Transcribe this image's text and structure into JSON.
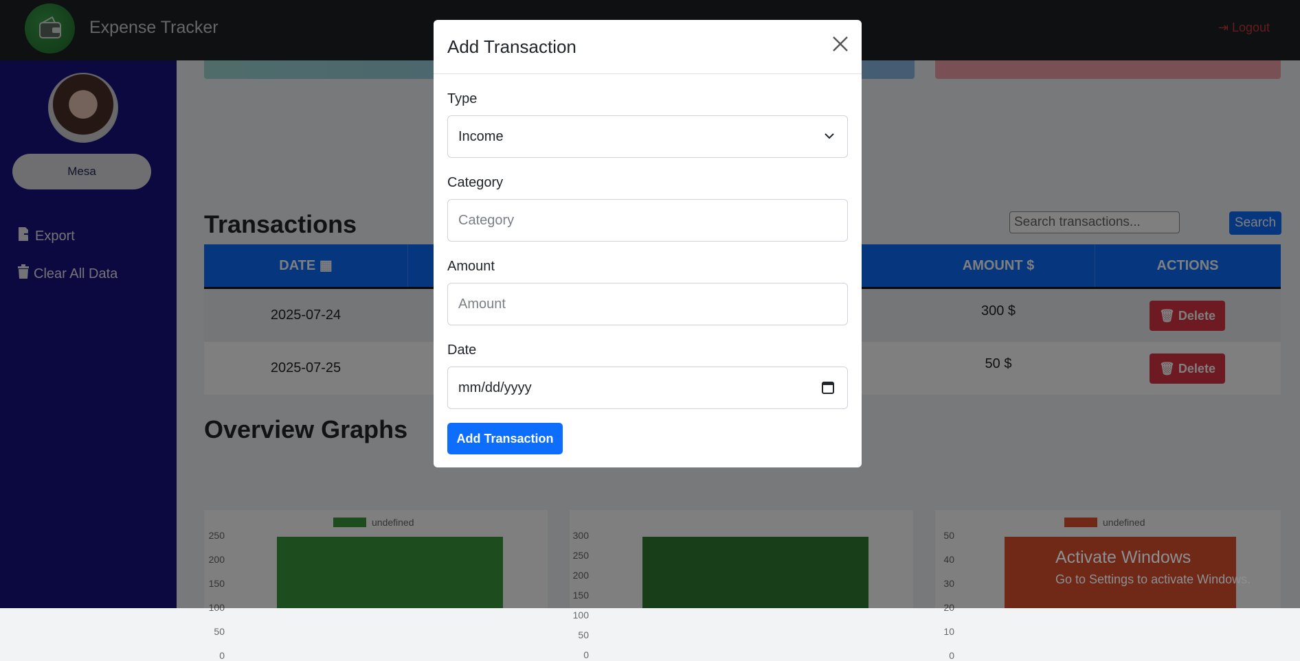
{
  "app": {
    "title": "Expense Tracker",
    "logout_label": "Logout"
  },
  "sidebar": {
    "user_name": "Mesa",
    "items": [
      {
        "label": "Export",
        "icon": "file-export-icon"
      },
      {
        "label": "Clear All Data",
        "icon": "trash-icon"
      }
    ]
  },
  "transactions": {
    "heading": "Transactions",
    "search_placeholder": "Search transactions...",
    "search_label": "Search",
    "columns": {
      "date": "DATE",
      "amount": "AMOUNT $",
      "actions": "ACTIONS"
    },
    "rows": [
      {
        "date": "2025-07-24",
        "amount": "300 $",
        "action": "Delete"
      },
      {
        "date": "2025-07-25",
        "amount": "50 $",
        "action": "Delete"
      }
    ]
  },
  "graphs": {
    "heading": "Overview Graphs",
    "charts": [
      {
        "legend": "undefined",
        "ticks": [
          "250",
          "200",
          "150",
          "100",
          "50",
          "0"
        ],
        "color": "#3a9b3f"
      },
      {
        "legend": "",
        "ticks": [
          "300",
          "250",
          "200",
          "150",
          "100",
          "50",
          "0"
        ],
        "color": "#2e7d32"
      },
      {
        "legend": "undefined",
        "ticks": [
          "50",
          "40",
          "30",
          "20",
          "10",
          "0"
        ],
        "color": "#e0522d"
      }
    ]
  },
  "chart_data": [
    {
      "type": "bar",
      "series": [
        {
          "name": "undefined",
          "values": [
            250
          ]
        }
      ],
      "ylim": [
        0,
        250
      ]
    },
    {
      "type": "bar",
      "series": [
        {
          "values": [
            300
          ]
        }
      ],
      "ylim": [
        0,
        300
      ]
    },
    {
      "type": "bar",
      "series": [
        {
          "name": "undefined",
          "values": [
            50
          ]
        }
      ],
      "ylim": [
        0,
        50
      ]
    }
  ],
  "modal": {
    "title": "Add Transaction",
    "type_label": "Type",
    "type_value": "Income",
    "category_label": "Category",
    "category_placeholder": "Category",
    "amount_label": "Amount",
    "amount_placeholder": "Amount",
    "date_label": "Date",
    "date_placeholder": "mm/dd/yyyy",
    "submit_label": "Add Transaction"
  },
  "watermark": {
    "title": "Activate Windows",
    "subtitle": "Go to Settings to activate Windows."
  },
  "colors": {
    "primary": "#0d6efd",
    "danger": "#dc3545",
    "sidebar": "#17137f",
    "nav": "#1f2023"
  }
}
